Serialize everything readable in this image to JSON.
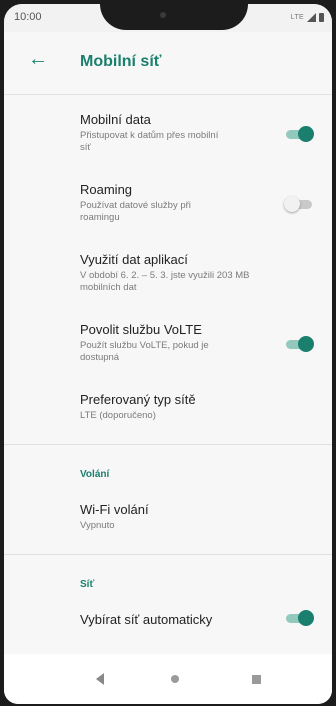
{
  "status_bar": {
    "time": "10:00",
    "network": "LTE",
    "icons": [
      "signal-icon",
      "battery-icon"
    ]
  },
  "app_bar": {
    "back_icon": "arrow-left-icon",
    "title": "Mobilní síť"
  },
  "colors": {
    "accent": "#1a7f6d",
    "toggle_off_track": "#c9c9c9"
  },
  "settings": {
    "mobile_data": {
      "label": "Mobilní data",
      "sub1": "Přistupovat k datům přes mobilní",
      "sub2": "síť",
      "enabled": true
    },
    "roaming": {
      "label": "Roaming",
      "sub1": "Používat datové služby při",
      "sub2": "roamingu",
      "enabled": false
    },
    "data_usage": {
      "label": "Využití dat aplikací",
      "sub1": "V období 6. 2. – 5. 3. jste využili 203 MB",
      "sub2": "mobilních dat"
    },
    "volte": {
      "label": "Povolit službu VoLTE",
      "sub1": "Použít službu VoLTE, pokud je",
      "sub2": "dostupná",
      "enabled": true
    },
    "network_type": {
      "label": "Preferovaný typ sítě",
      "sub": "LTE (doporučeno)"
    }
  },
  "sections": {
    "calls": {
      "header": "Volání",
      "wifi_calling": {
        "label": "Wi-Fi volání",
        "sub": "Vypnuto"
      }
    },
    "network": {
      "header": "Síť",
      "partial_item": {
        "label": "Vybírat síť automaticky",
        "enabled": true
      }
    }
  },
  "nav_bar": {
    "icons": [
      "back-triangle-icon",
      "home-circle-icon",
      "recents-square-icon"
    ]
  }
}
